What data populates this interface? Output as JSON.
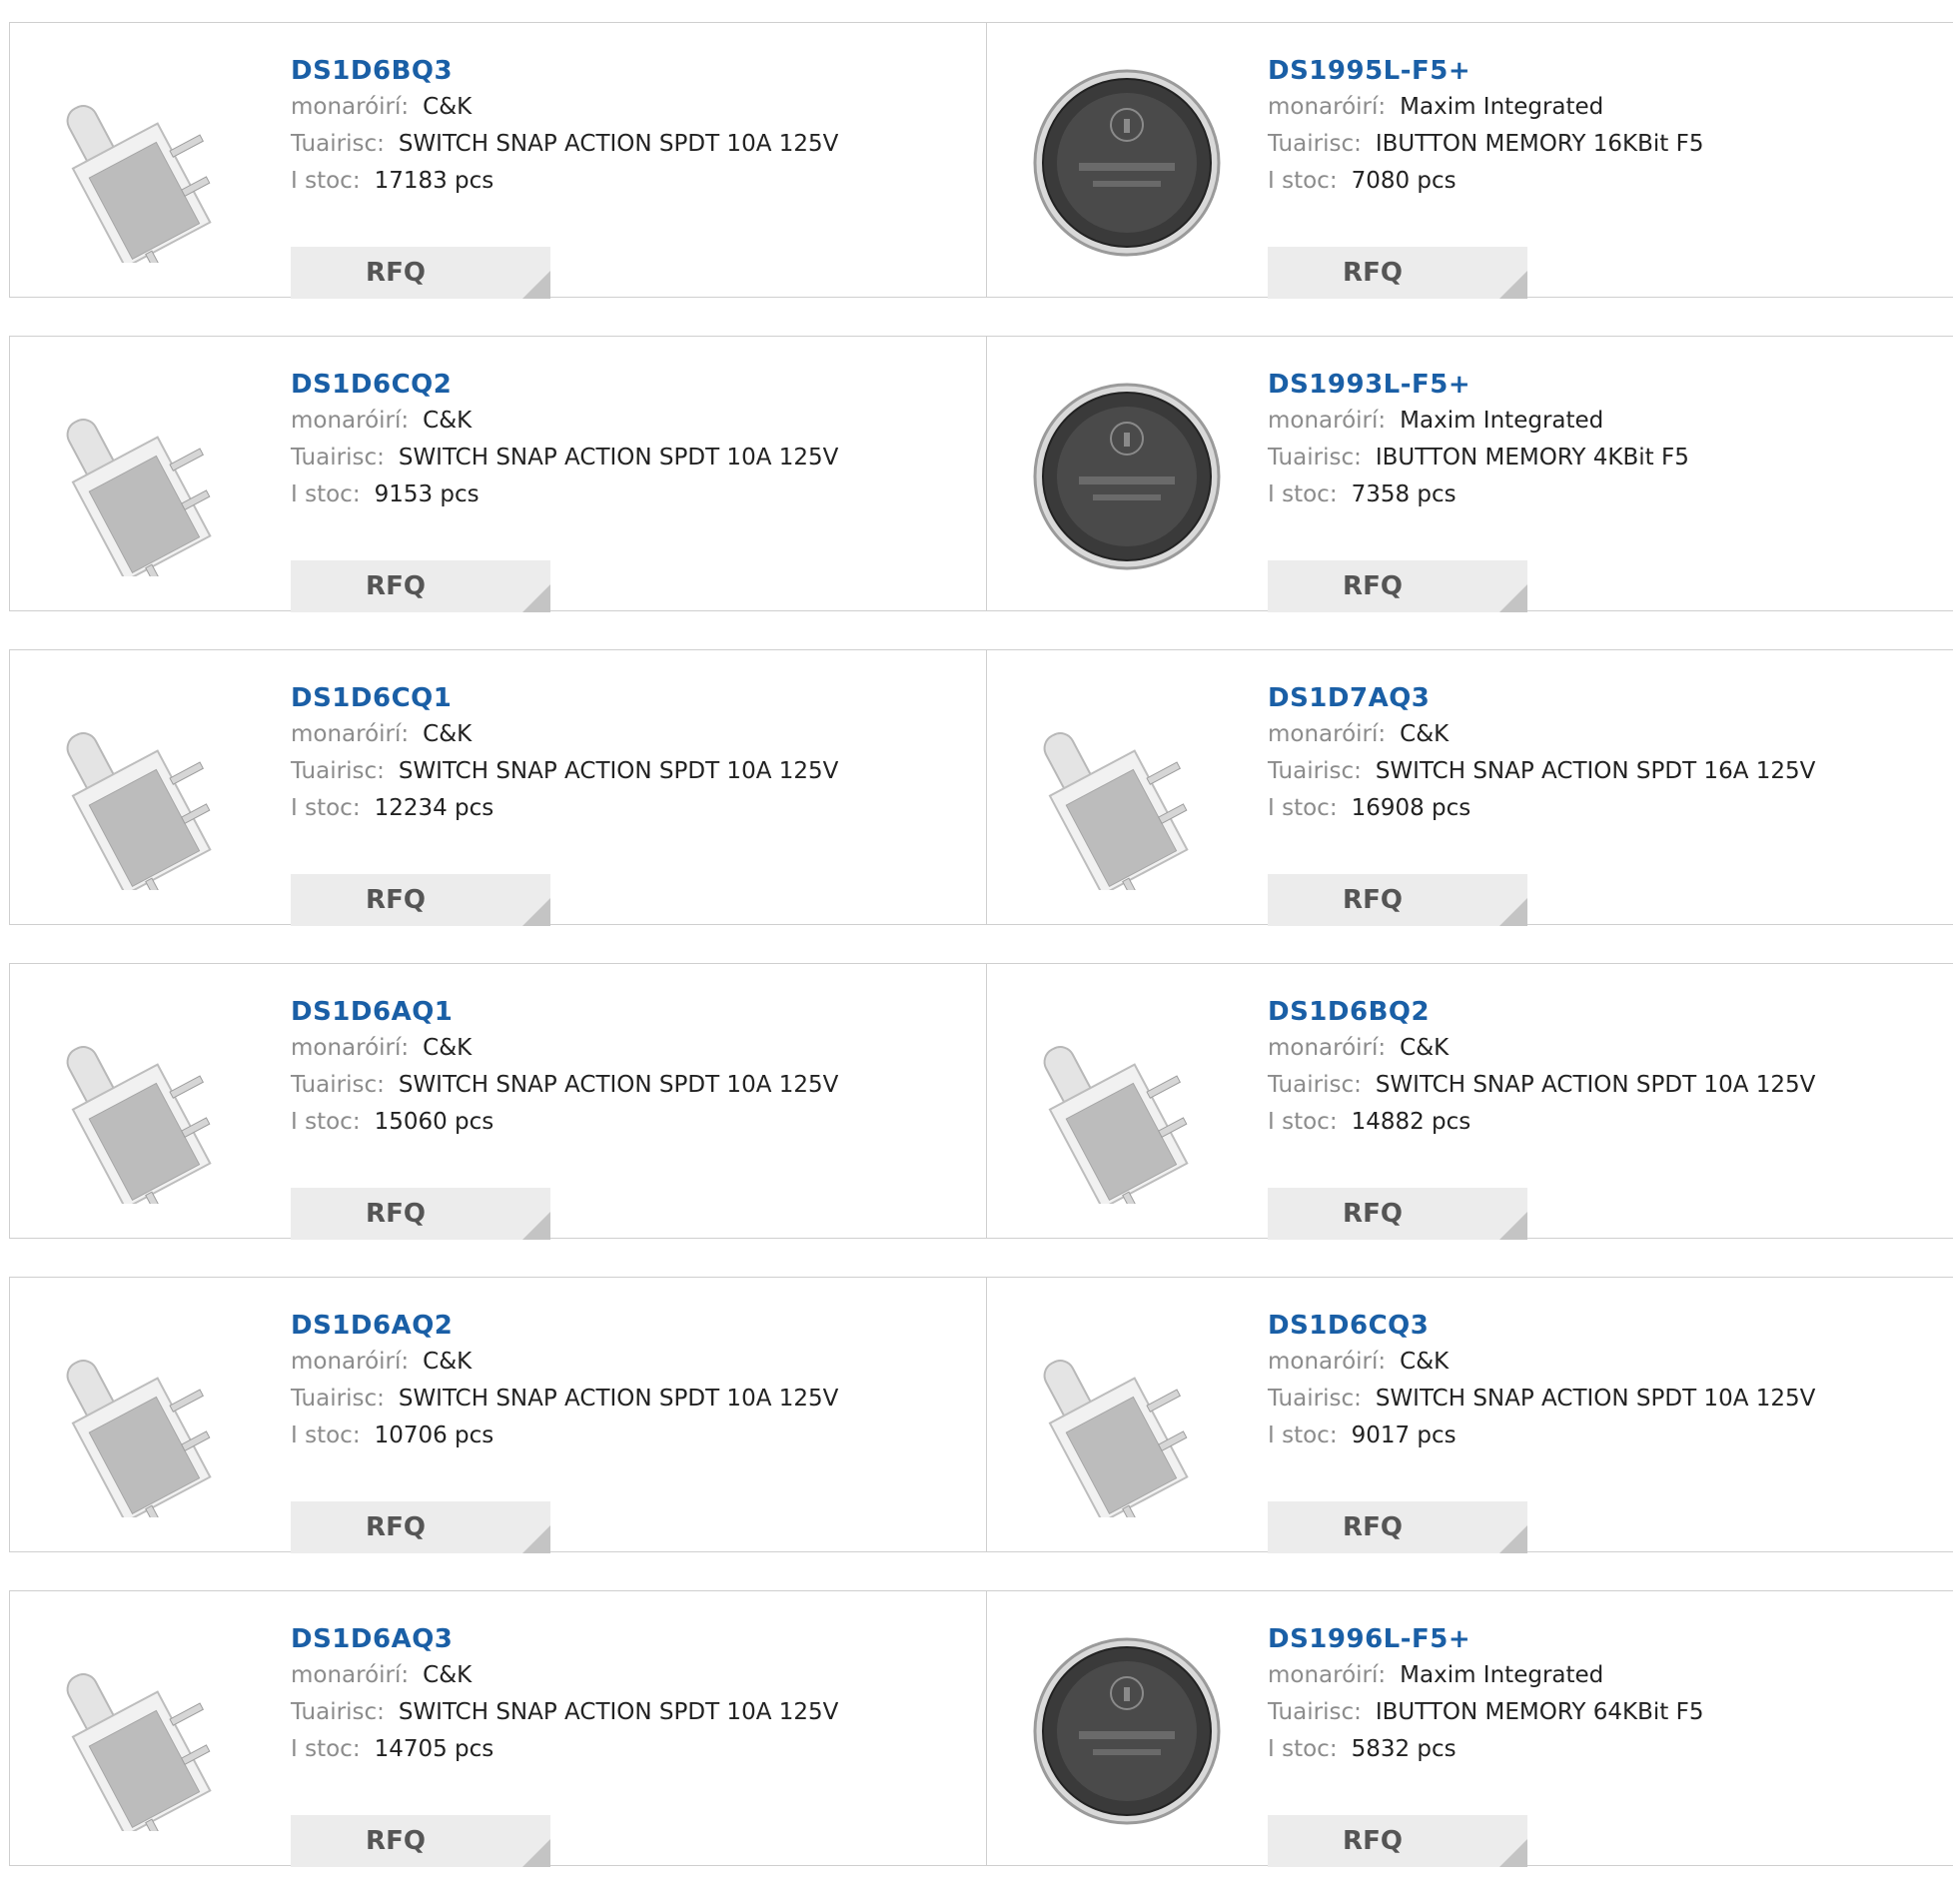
{
  "labels": {
    "manufacturer": "monaróirí:",
    "description": "Tuairisc:",
    "stock": "I stoc:",
    "rfq": "RFQ"
  },
  "products": [
    {
      "part": "DS1D6BQ3",
      "manufacturer": "C&K",
      "description": "SWITCH SNAP ACTION SPDT 10A 125V",
      "stock": "17183 pcs",
      "image": "snap-switch-icon"
    },
    {
      "part": "DS1995L-F5+",
      "manufacturer": "Maxim Integrated",
      "description": "IBUTTON MEMORY 16KBit F5",
      "stock": "7080 pcs",
      "image": "ibutton-icon"
    },
    {
      "part": "DS1D6CQ2",
      "manufacturer": "C&K",
      "description": "SWITCH SNAP ACTION SPDT 10A 125V",
      "stock": "9153 pcs",
      "image": "snap-switch-icon"
    },
    {
      "part": "DS1993L-F5+",
      "manufacturer": "Maxim Integrated",
      "description": "IBUTTON MEMORY 4KBit F5",
      "stock": "7358 pcs",
      "image": "ibutton-icon"
    },
    {
      "part": "DS1D6CQ1",
      "manufacturer": "C&K",
      "description": "SWITCH SNAP ACTION SPDT 10A 125V",
      "stock": "12234 pcs",
      "image": "snap-switch-icon"
    },
    {
      "part": "DS1D7AQ3",
      "manufacturer": "C&K",
      "description": "SWITCH SNAP ACTION SPDT 16A 125V",
      "stock": "16908 pcs",
      "image": "snap-switch-icon"
    },
    {
      "part": "DS1D6AQ1",
      "manufacturer": "C&K",
      "description": "SWITCH SNAP ACTION SPDT 10A 125V",
      "stock": "15060 pcs",
      "image": "snap-switch-icon"
    },
    {
      "part": "DS1D6BQ2",
      "manufacturer": "C&K",
      "description": "SWITCH SNAP ACTION SPDT 10A 125V",
      "stock": "14882 pcs",
      "image": "snap-switch-icon"
    },
    {
      "part": "DS1D6AQ2",
      "manufacturer": "C&K",
      "description": "SWITCH SNAP ACTION SPDT 10A 125V",
      "stock": "10706 pcs",
      "image": "snap-switch-icon"
    },
    {
      "part": "DS1D6CQ3",
      "manufacturer": "C&K",
      "description": "SWITCH SNAP ACTION SPDT 10A 125V",
      "stock": "9017 pcs",
      "image": "snap-switch-icon"
    },
    {
      "part": "DS1D6AQ3",
      "manufacturer": "C&K",
      "description": "SWITCH SNAP ACTION SPDT 10A 125V",
      "stock": "14705 pcs",
      "image": "snap-switch-icon"
    },
    {
      "part": "DS1996L-F5+",
      "manufacturer": "Maxim Integrated",
      "description": "IBUTTON MEMORY 64KBit F5",
      "stock": "5832 pcs",
      "image": "ibutton-icon"
    }
  ],
  "colors": {
    "part_link": "#1a5fa6",
    "label": "#8c8c8c",
    "rfq_bg": "#ececec"
  }
}
